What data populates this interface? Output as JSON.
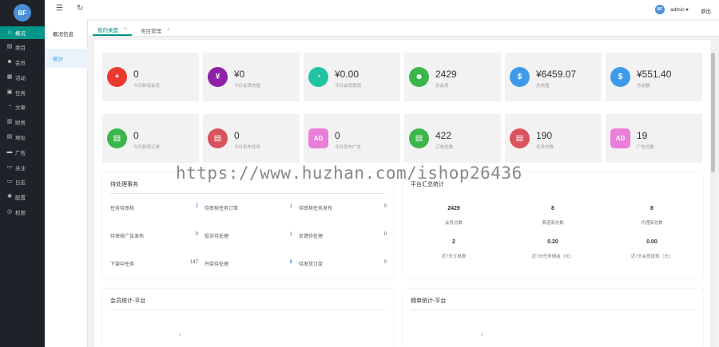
{
  "logo": {
    "text": "BF"
  },
  "sidebar": {
    "items": [
      {
        "label": "概况",
        "icon": "⌂",
        "active": true
      },
      {
        "label": "类目",
        "icon": "▤"
      },
      {
        "label": "会员",
        "icon": "☻"
      },
      {
        "label": "活动",
        "icon": "▦"
      },
      {
        "label": "任务",
        "icon": "▣"
      },
      {
        "label": "文章",
        "icon": "◔"
      },
      {
        "label": "财务",
        "icon": "▥"
      },
      {
        "label": "地址",
        "icon": "▤"
      },
      {
        "label": "广告",
        "icon": "▬"
      },
      {
        "label": "关注",
        "icon": "▭"
      },
      {
        "label": "日志",
        "icon": "▭"
      },
      {
        "label": "配置",
        "icon": "✱"
      },
      {
        "label": "权限",
        "icon": "◎"
      }
    ]
  },
  "subnav": {
    "items": [
      {
        "label": "概况信息"
      },
      {
        "label": "统计",
        "active": true
      }
    ]
  },
  "header": {
    "menu_icon": "☰",
    "refresh_icon": "↻",
    "avatar_text": "BF",
    "user": "admin ▾",
    "logout": "退出"
  },
  "tabs": [
    {
      "label": "我的桌面",
      "close": "×",
      "active": true
    },
    {
      "label": "类目管理",
      "close": "×"
    }
  ],
  "cards_row1": [
    {
      "value": "0",
      "label": "今日新增会员",
      "color": "#ea3a2e",
      "icon": "+"
    },
    {
      "value": "¥0",
      "label": "今日会员充值",
      "color": "#8e21a8",
      "icon": "¥"
    },
    {
      "value": "¥0.00",
      "label": "今日会员提现",
      "color": "#22c3a0",
      "icon": "◔"
    },
    {
      "value": "2429",
      "label": "总会员",
      "color": "#3cb64a",
      "icon": "☻"
    },
    {
      "value": "¥6459.07",
      "label": "总充值",
      "color": "#3d9be9",
      "icon": "$"
    },
    {
      "value": "¥551.40",
      "label": "总余额",
      "color": "#3d9be9",
      "icon": "$"
    }
  ],
  "cards_row2": [
    {
      "value": "0",
      "label": "今日新增订单",
      "color": "#3cb64a",
      "icon": "▤",
      "shape": "circle"
    },
    {
      "value": "0",
      "label": "今日发布任务",
      "color": "#d9525e",
      "icon": "▤",
      "shape": "circle"
    },
    {
      "value": "0",
      "label": "今日发布广告",
      "color": "#e97fd9",
      "icon": "AD",
      "shape": "square"
    },
    {
      "value": "422",
      "label": "订单总数",
      "color": "#3cb64a",
      "icon": "▤",
      "shape": "circle"
    },
    {
      "value": "190",
      "label": "任务总数",
      "color": "#d9525e",
      "icon": "▤",
      "shape": "circle"
    },
    {
      "value": "19",
      "label": "广告总数",
      "color": "#e97fd9",
      "icon": "AD",
      "shape": "square"
    }
  ],
  "todo": {
    "title": "待处理事务",
    "rows": [
      [
        {
          "label": "任务待审核",
          "value": "2",
          "blue": true
        },
        {
          "label": "待审核任务订单",
          "value": "1",
          "blue": true
        },
        {
          "label": "待审核任务发布",
          "value": "0"
        }
      ],
      [
        {
          "label": "待审核广告发布",
          "value": "0"
        },
        {
          "label": "投诉待处理",
          "value": "1",
          "blue": true
        },
        {
          "label": "反馈待处理",
          "value": "0"
        }
      ],
      [
        {
          "label": "下架中任务",
          "value": "147"
        },
        {
          "label": "开奖待处理",
          "value": "8",
          "blue": true
        },
        {
          "label": "待发货订单",
          "value": "0"
        }
      ]
    ]
  },
  "platform": {
    "title": "平台汇总统计",
    "rows": [
      [
        {
          "value": "2429",
          "label": "会员总数"
        },
        {
          "value": "8",
          "label": "渠道商总数"
        },
        {
          "value": "8",
          "label": "代理商总数"
        }
      ],
      [
        {
          "value": "2",
          "label": "近7天订单数"
        },
        {
          "value": "0.20",
          "label": "近7天任务佣金（元）"
        },
        {
          "value": "0.00",
          "label": "近7天会员提现（元）"
        }
      ]
    ]
  },
  "bottom": {
    "member_title": "会员统计-平台",
    "order_title": "佣单统计-平台",
    "member_tick": "1",
    "order_tick": "2"
  },
  "watermark": "https://www.huzhan.com/ishop26436"
}
